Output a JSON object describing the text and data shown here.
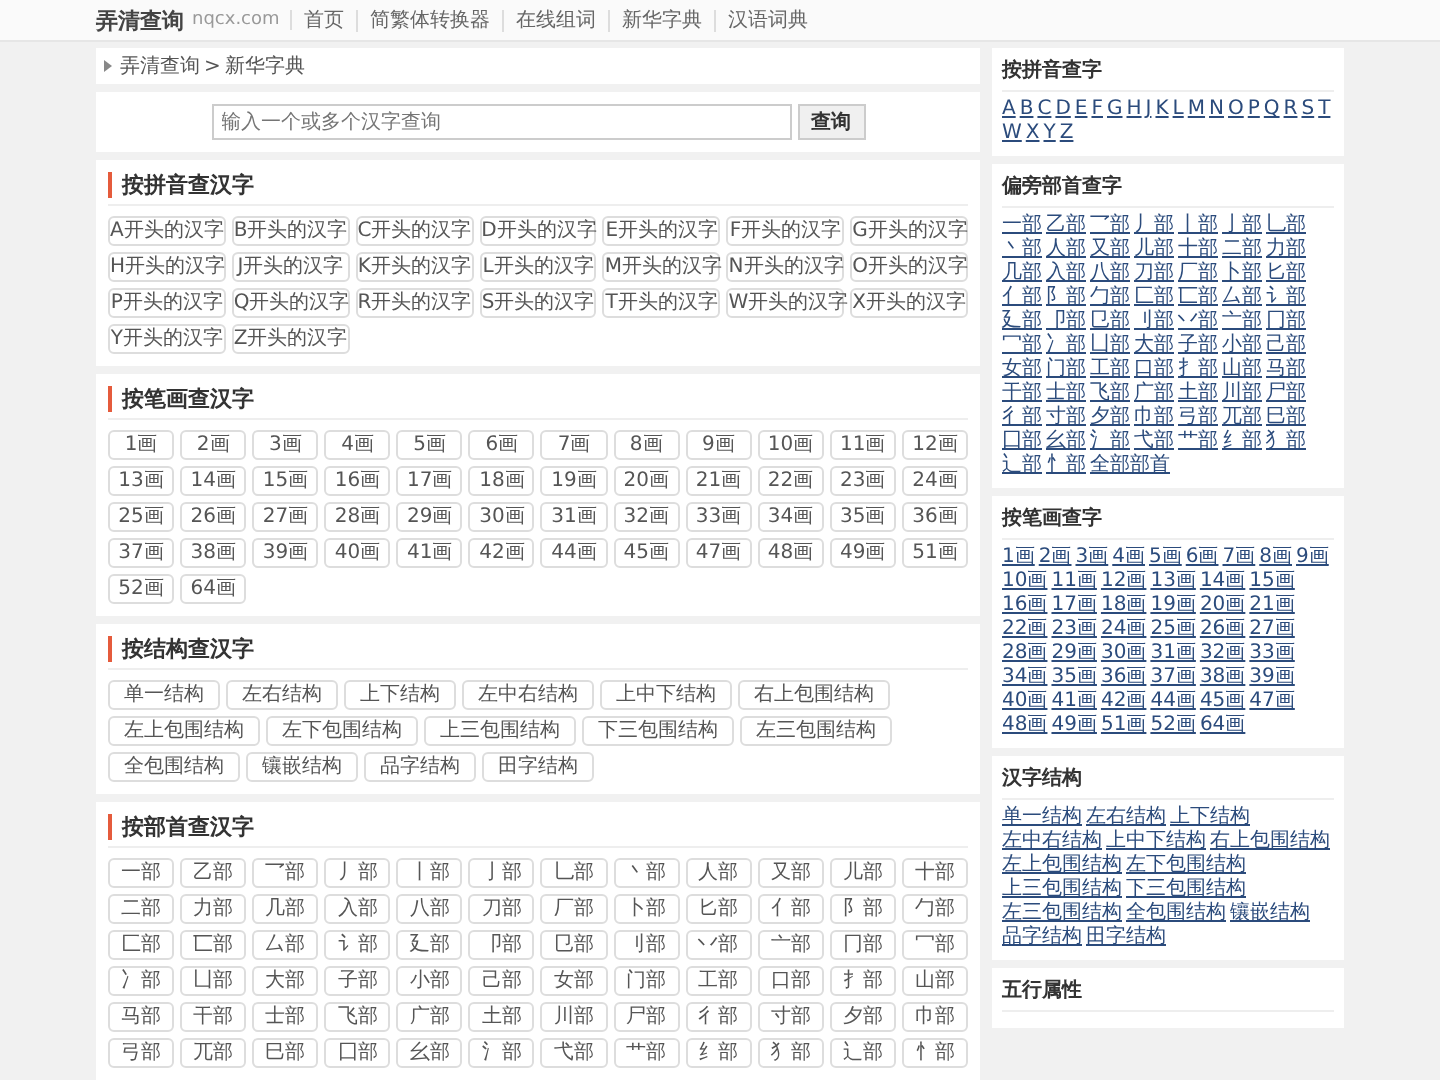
{
  "header": {
    "site_name": "弄清查询",
    "domain": "nqcx.com",
    "nav": [
      "首页",
      "简繁体转换器",
      "在线组词",
      "新华字典",
      "汉语词典"
    ]
  },
  "breadcrumb": [
    "弄清查询",
    ">",
    "新华字典"
  ],
  "search": {
    "placeholder": "输入一个或多个汉字查询",
    "button": "查询"
  },
  "sections": [
    {
      "title": "按拼音查汉字",
      "kind": "wide",
      "items": [
        "A开头的汉字",
        "B开头的汉字",
        "C开头的汉字",
        "D开头的汉字",
        "E开头的汉字",
        "F开头的汉字",
        "G开头的汉字",
        "H开头的汉字",
        "J开头的汉字",
        "K开头的汉字",
        "L开头的汉字",
        "M开头的汉字",
        "N开头的汉字",
        "O开头的汉字",
        "P开头的汉字",
        "Q开头的汉字",
        "R开头的汉字",
        "S开头的汉字",
        "T开头的汉字",
        "W开头的汉字",
        "X开头的汉字",
        "Y开头的汉字",
        "Z开头的汉字"
      ]
    },
    {
      "title": "按笔画查汉字",
      "kind": "narrow",
      "items": [
        "1画",
        "2画",
        "3画",
        "4画",
        "5画",
        "6画",
        "7画",
        "8画",
        "9画",
        "10画",
        "11画",
        "12画",
        "13画",
        "14画",
        "15画",
        "16画",
        "17画",
        "18画",
        "19画",
        "20画",
        "21画",
        "22画",
        "23画",
        "24画",
        "25画",
        "26画",
        "27画",
        "28画",
        "29画",
        "30画",
        "31画",
        "32画",
        "33画",
        "34画",
        "35画",
        "36画",
        "37画",
        "38画",
        "39画",
        "40画",
        "41画",
        "42画",
        "44画",
        "45画",
        "47画",
        "48画",
        "49画",
        "51画",
        "52画",
        "64画"
      ]
    },
    {
      "title": "按结构查汉字",
      "kind": "flow",
      "items": [
        "单一结构",
        "左右结构",
        "上下结构",
        "左中右结构",
        "上中下结构",
        "右上包围结构",
        "左上包围结构",
        "左下包围结构",
        "上三包围结构",
        "下三包围结构",
        "左三包围结构",
        "全包围结构",
        "镶嵌结构",
        "品字结构",
        "田字结构"
      ]
    },
    {
      "title": "按部首查汉字",
      "kind": "narrow",
      "items": [
        "一部",
        "乙部",
        "乛部",
        "丿部",
        "丨部",
        "亅部",
        "乚部",
        "丶部",
        "人部",
        "又部",
        "儿部",
        "十部",
        "二部",
        "力部",
        "几部",
        "入部",
        "八部",
        "刀部",
        "厂部",
        "卜部",
        "匕部",
        "亻部",
        "阝部",
        "勹部",
        "匚部",
        "匸部",
        "厶部",
        "讠部",
        "廴部",
        "卩部",
        "㔾部",
        "刂部",
        "丷部",
        "亠部",
        "冂部",
        "冖部",
        "冫部",
        "凵部",
        "大部",
        "子部",
        "小部",
        "己部",
        "女部",
        "门部",
        "工部",
        "口部",
        "扌部",
        "山部",
        "马部",
        "干部",
        "士部",
        "飞部",
        "广部",
        "土部",
        "川部",
        "尸部",
        "彳部",
        "寸部",
        "夕部",
        "巾部",
        "弓部",
        "兀部",
        "巳部",
        "囗部",
        "幺部",
        "氵部",
        "弋部",
        "艹部",
        "纟部",
        "犭部",
        "辶部",
        "忄部"
      ]
    }
  ],
  "sidebar": [
    {
      "title": "按拼音查字",
      "items": [
        "A",
        "B",
        "C",
        "D",
        "E",
        "F",
        "G",
        "H",
        "J",
        "K",
        "L",
        "M",
        "N",
        "O",
        "P",
        "Q",
        "R",
        "S",
        "T",
        "W",
        "X",
        "Y",
        "Z"
      ]
    },
    {
      "title": "偏旁部首查字",
      "items": [
        "一部",
        "乙部",
        "乛部",
        "丿部",
        "丨部",
        "亅部",
        "乚部",
        "丶部",
        "人部",
        "又部",
        "儿部",
        "十部",
        "二部",
        "力部",
        "几部",
        "入部",
        "八部",
        "刀部",
        "厂部",
        "卜部",
        "匕部",
        "亻部",
        "阝部",
        "勹部",
        "匚部",
        "匸部",
        "厶部",
        "讠部",
        "廴部",
        "卩部",
        "㔾部",
        "刂部",
        "丷部",
        "亠部",
        "冂部",
        "冖部",
        "冫部",
        "凵部",
        "大部",
        "子部",
        "小部",
        "己部",
        "女部",
        "门部",
        "工部",
        "口部",
        "扌部",
        "山部",
        "马部",
        "干部",
        "士部",
        "飞部",
        "广部",
        "土部",
        "川部",
        "尸部",
        "彳部",
        "寸部",
        "夕部",
        "巾部",
        "弓部",
        "兀部",
        "巳部",
        "囗部",
        "幺部",
        "氵部",
        "弋部",
        "艹部",
        "纟部",
        "犭部",
        "辶部",
        "忄部",
        "全部部首"
      ]
    },
    {
      "title": "按笔画查字",
      "items": [
        "1画",
        "2画",
        "3画",
        "4画",
        "5画",
        "6画",
        "7画",
        "8画",
        "9画",
        "10画",
        "11画",
        "12画",
        "13画",
        "14画",
        "15画",
        "16画",
        "17画",
        "18画",
        "19画",
        "20画",
        "21画",
        "22画",
        "23画",
        "24画",
        "25画",
        "26画",
        "27画",
        "28画",
        "29画",
        "30画",
        "31画",
        "32画",
        "33画",
        "34画",
        "35画",
        "36画",
        "37画",
        "38画",
        "39画",
        "40画",
        "41画",
        "42画",
        "44画",
        "45画",
        "47画",
        "48画",
        "49画",
        "51画",
        "52画",
        "64画"
      ]
    },
    {
      "title": "汉字结构",
      "items": [
        "单一结构",
        "左右结构",
        "上下结构",
        "左中右结构",
        "上中下结构",
        "右上包围结构",
        "左上包围结构",
        "左下包围结构",
        "上三包围结构",
        "下三包围结构",
        "左三包围结构",
        "全包围结构",
        "镶嵌结构",
        "品字结构",
        "田字结构"
      ]
    },
    {
      "title": "五行属性"
    }
  ]
}
